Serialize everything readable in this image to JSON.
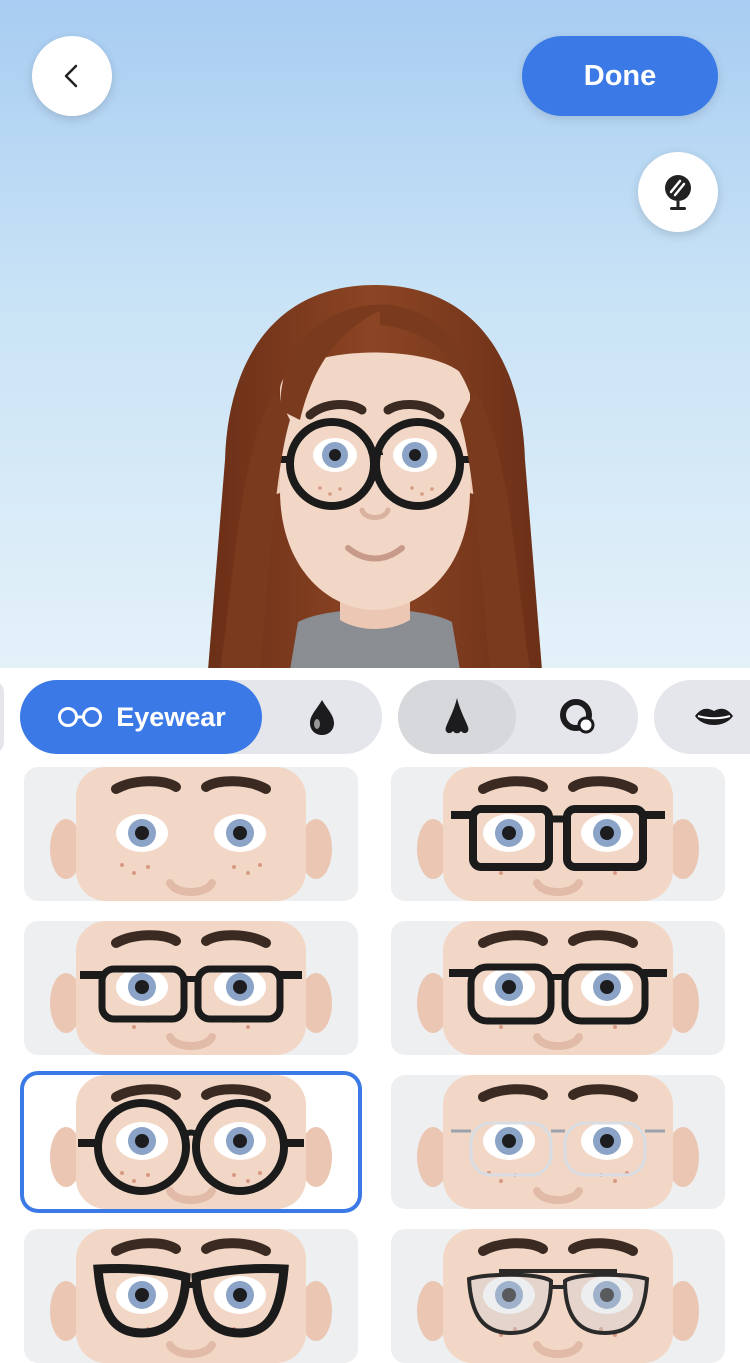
{
  "header": {
    "back_icon": "chevron-left-icon",
    "done_label": "Done",
    "mirror_icon": "mirror-icon"
  },
  "categories": {
    "active_label": "Eyewear",
    "active_icon": "glasses-icon",
    "items": [
      "eye-color-icon",
      "nose-icon",
      "nose-ring-icon",
      "lips-icon"
    ]
  },
  "eyewear_options": [
    {
      "style": "none",
      "selected": false
    },
    {
      "style": "square-thick",
      "selected": false
    },
    {
      "style": "rectangle-thick",
      "selected": false
    },
    {
      "style": "rectangle-rounded",
      "selected": false
    },
    {
      "style": "round-thick",
      "selected": true
    },
    {
      "style": "rimless-clear",
      "selected": false
    },
    {
      "style": "cat-eye",
      "selected": false
    },
    {
      "style": "aviator",
      "selected": false
    }
  ],
  "colors": {
    "accent": "#3b7ae6",
    "hair": "#7a3a1e",
    "skin": "#f3d7c6"
  }
}
